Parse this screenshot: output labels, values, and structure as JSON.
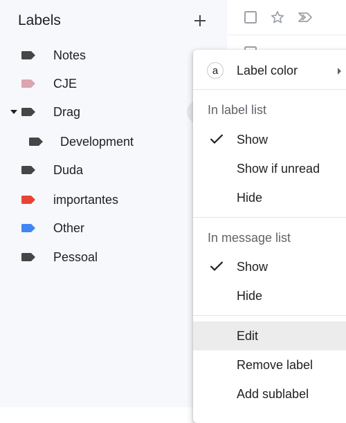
{
  "sidebar": {
    "title": "Labels",
    "labels": [
      {
        "name": "Notes",
        "color": "#444746"
      },
      {
        "name": "CJE",
        "color": "#dba5b0"
      },
      {
        "name": "Drag",
        "color": "#444746"
      },
      {
        "name": "Development",
        "color": "#444746"
      },
      {
        "name": "Duda",
        "color": "#444746"
      },
      {
        "name": "importantes",
        "color": "#ea4335"
      },
      {
        "name": "Other",
        "color": "#4285f4"
      },
      {
        "name": "Pessoal",
        "color": "#444746"
      }
    ]
  },
  "icons": {
    "add": "plus-icon",
    "label": "label-tag-icon",
    "expand": "caret-down-icon",
    "checkbox": "checkbox-icon",
    "star": "star-icon",
    "important": "importance-marker-icon",
    "check": "checkmark-icon",
    "submenu": "chevron-right-icon"
  },
  "menu": {
    "label_color": "Label color",
    "label_color_swatch": "a",
    "in_label_list": "In label list",
    "label_list_options": [
      "Show",
      "Show if unread",
      "Hide"
    ],
    "in_message_list": "In message list",
    "message_list_options": [
      "Show",
      "Hide"
    ],
    "actions": [
      "Edit",
      "Remove label",
      "Add sublabel"
    ]
  }
}
